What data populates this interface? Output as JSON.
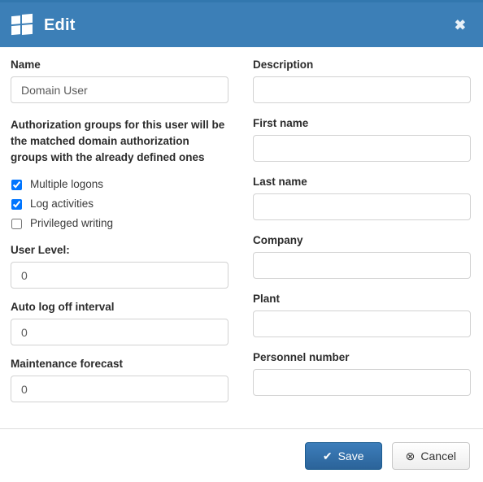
{
  "window": {
    "title": "Edit",
    "logo_icon": "windows-logo-icon",
    "close_icon": "close-icon",
    "close_label": "✖",
    "header_color": "#3c7fb7"
  },
  "form": {
    "left": {
      "name": {
        "label": "Name",
        "value": "Domain User",
        "placeholder": ""
      },
      "note": "Authorization groups for this user will be the matched domain authorization groups with the already defined ones",
      "checkboxes": [
        {
          "label": "Multiple logons",
          "checked": true
        },
        {
          "label": "Log activities",
          "checked": true
        },
        {
          "label": "Privileged writing",
          "checked": false
        }
      ],
      "user_level": {
        "label": "User Level:",
        "value": "0",
        "placeholder": ""
      },
      "auto_log_off": {
        "label": "Auto log off interval",
        "value": "0",
        "placeholder": ""
      },
      "maintenance_forecast": {
        "label": "Maintenance forecast",
        "value": "0",
        "placeholder": ""
      }
    },
    "right": {
      "description": {
        "label": "Description",
        "value": "",
        "placeholder": ""
      },
      "first_name": {
        "label": "First name",
        "value": "",
        "placeholder": ""
      },
      "last_name": {
        "label": "Last name",
        "value": "",
        "placeholder": ""
      },
      "company": {
        "label": "Company",
        "value": "",
        "placeholder": ""
      },
      "plant": {
        "label": "Plant",
        "value": "",
        "placeholder": ""
      },
      "personnel_number": {
        "label": "Personnel number",
        "value": "",
        "placeholder": ""
      }
    }
  },
  "footer": {
    "save_label": "Save",
    "save_icon": "checkmark-icon",
    "save_glyph": "✔",
    "cancel_label": "Cancel",
    "cancel_icon": "circled-x-icon",
    "cancel_glyph": "⊗"
  }
}
